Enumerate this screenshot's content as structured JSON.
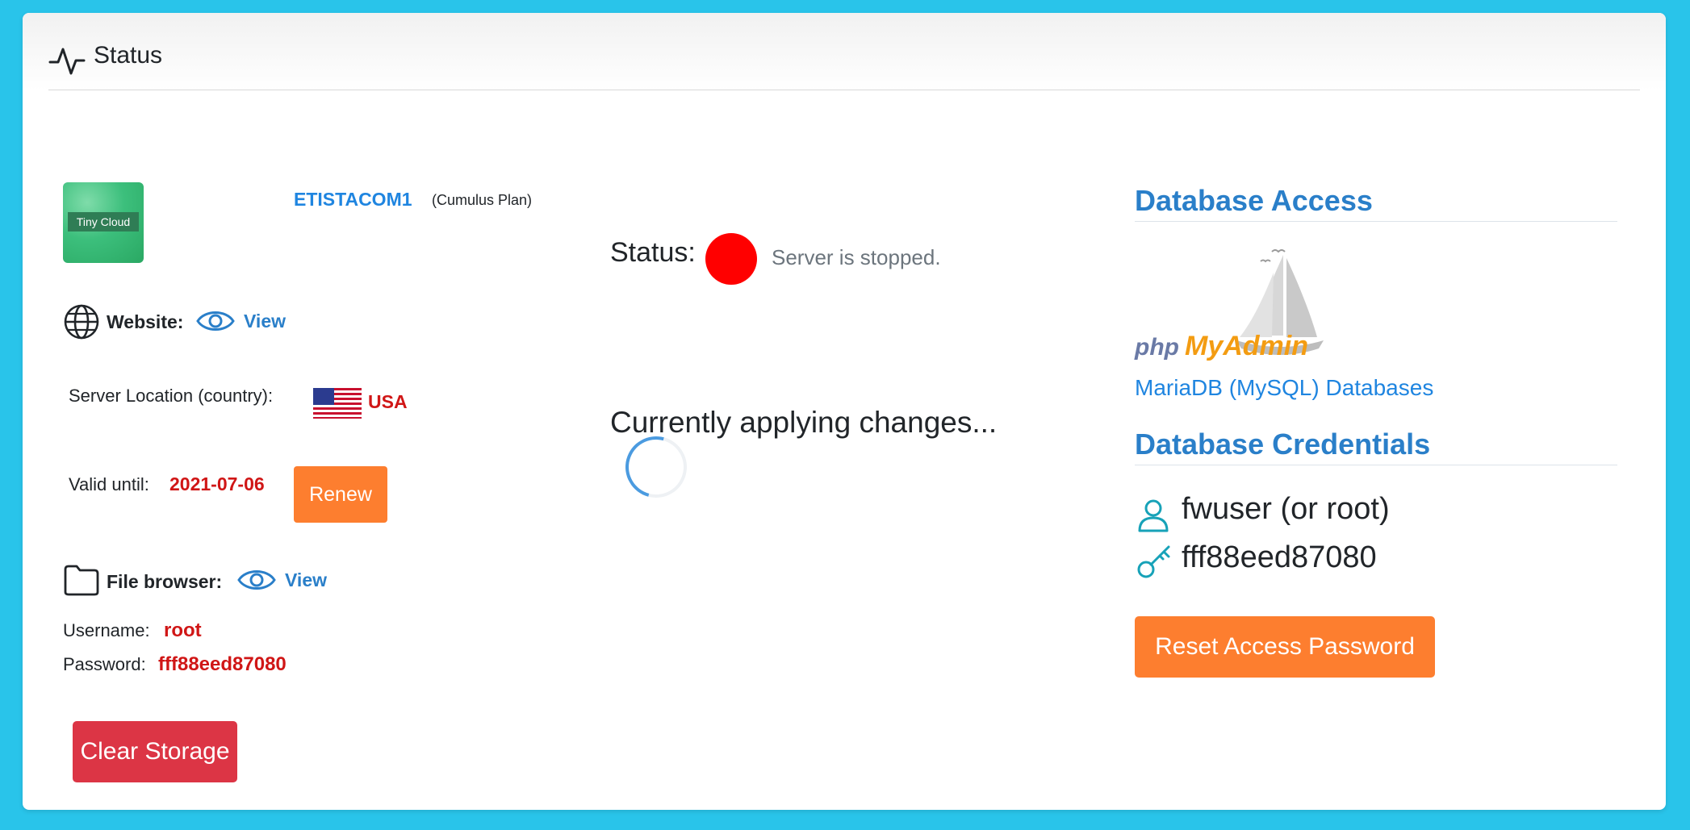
{
  "header": {
    "title": "Status",
    "icon": "activity-icon"
  },
  "plan": {
    "thumbnail_label": "Tiny Cloud",
    "name": "ETISTACOM1",
    "type": "(Cumulus Plan)"
  },
  "website": {
    "label": "Website:",
    "link": "View"
  },
  "location": {
    "label": "Server Location (country):",
    "country": "USA",
    "flag": "usa-flag-icon"
  },
  "validity": {
    "label": "Valid until:",
    "date": "2021-07-06",
    "renew_label": "Renew"
  },
  "file_browser": {
    "label": "File browser:",
    "link": "View",
    "username_label": "Username:",
    "username": "root",
    "password_label": "Password:",
    "password": "fff88eed87080"
  },
  "clear_storage_label": "Clear Storage",
  "server_status": {
    "label": "Status:",
    "text": "Server is stopped.",
    "color": "#ff0000"
  },
  "applying_text": "Currently applying changes...",
  "database_access": {
    "title": "Database Access",
    "logo_php": "php",
    "logo_myadmin": "MyAdmin",
    "link": "MariaDB (MySQL) Databases"
  },
  "database_credentials": {
    "title": "Database Credentials",
    "user": "fwuser (or root)",
    "password": "fff88eed87080",
    "reset_label": "Reset Access Password"
  },
  "colors": {
    "background": "#29c4ea",
    "accent_blue": "#2a7fc9",
    "orange": "#fd7e2f",
    "danger": "#dc3545",
    "value_red": "#d01616"
  }
}
